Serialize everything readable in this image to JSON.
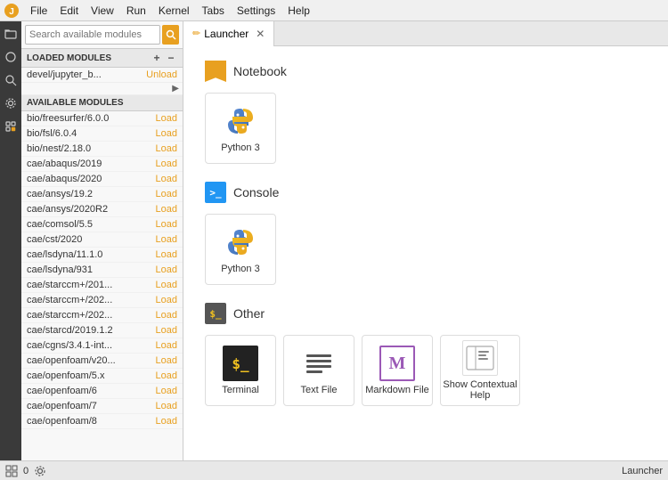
{
  "menubar": {
    "items": [
      "File",
      "Edit",
      "View",
      "Run",
      "Kernel",
      "Tabs",
      "Settings",
      "Help"
    ]
  },
  "sidebar": {
    "icons": [
      "folder",
      "circle",
      "search",
      "gear",
      "puzzle",
      "circle-dot"
    ]
  },
  "modules_panel": {
    "search_placeholder": "Search available modules",
    "loaded_section_label": "LOADED MODULES",
    "available_section_label": "AVAILABLE MODULES",
    "loaded_modules": [
      {
        "name": "devel/jupyter_b...",
        "action": "Unload"
      }
    ],
    "available_modules": [
      {
        "name": "bio/freesurfer/6.0.0",
        "action": "Load"
      },
      {
        "name": "bio/fsl/6.0.4",
        "action": "Load"
      },
      {
        "name": "bio/nest/2.18.0",
        "action": "Load"
      },
      {
        "name": "cae/abaqus/2019",
        "action": "Load"
      },
      {
        "name": "cae/abaqus/2020",
        "action": "Load"
      },
      {
        "name": "cae/ansys/19.2",
        "action": "Load"
      },
      {
        "name": "cae/ansys/2020R2",
        "action": "Load"
      },
      {
        "name": "cae/comsol/5.5",
        "action": "Load"
      },
      {
        "name": "cae/cst/2020",
        "action": "Load"
      },
      {
        "name": "cae/lsdyna/11.1.0",
        "action": "Load"
      },
      {
        "name": "cae/lsdyna/931",
        "action": "Load"
      },
      {
        "name": "cae/starccm+/201...",
        "action": "Load"
      },
      {
        "name": "cae/starccm+/202...",
        "action": "Load"
      },
      {
        "name": "cae/starccm+/202...",
        "action": "Load"
      },
      {
        "name": "cae/starcd/2019.1.2",
        "action": "Load"
      },
      {
        "name": "cae/cgns/3.4.1-int...",
        "action": "Load"
      },
      {
        "name": "cae/openfoam/v20...",
        "action": "Load"
      },
      {
        "name": "cae/openfoam/5.x",
        "action": "Load"
      },
      {
        "name": "cae/openfoam/6",
        "action": "Load"
      },
      {
        "name": "cae/openfoam/7",
        "action": "Load"
      },
      {
        "name": "cae/openfoam/8",
        "action": "Load"
      }
    ]
  },
  "tab": {
    "label": "Launcher",
    "icon": "launcher-icon"
  },
  "launcher": {
    "sections": [
      {
        "id": "notebook",
        "label": "Notebook",
        "icon_type": "bookmark",
        "cards": [
          {
            "label": "Python 3",
            "icon_type": "python"
          }
        ]
      },
      {
        "id": "console",
        "label": "Console",
        "icon_type": "console",
        "cards": [
          {
            "label": "Python 3",
            "icon_type": "python"
          }
        ]
      },
      {
        "id": "other",
        "label": "Other",
        "icon_type": "other",
        "cards": [
          {
            "label": "Terminal",
            "icon_type": "terminal"
          },
          {
            "label": "Text File",
            "icon_type": "textfile"
          },
          {
            "label": "Markdown File",
            "icon_type": "markdown"
          },
          {
            "label": "Show Contextual Help",
            "icon_type": "help"
          }
        ]
      }
    ]
  },
  "statusbar": {
    "left_icon1": "grid-icon",
    "count": "0",
    "right_icon": "gear-icon",
    "right_label": "Launcher"
  }
}
